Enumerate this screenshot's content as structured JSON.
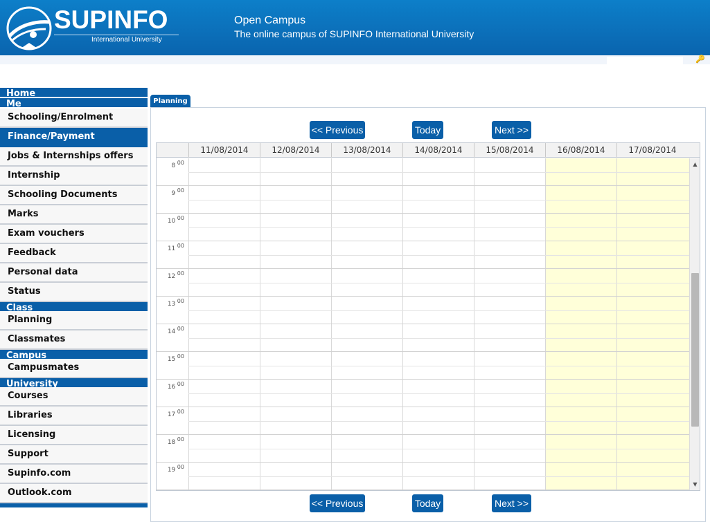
{
  "header": {
    "logo_text": "SUPINFO",
    "logo_subtitle": "International University",
    "site_title": "Open Campus",
    "site_tagline": "The online campus of SUPINFO International University"
  },
  "sidebar": {
    "home": "Home",
    "me": {
      "title": "Me",
      "items": [
        "Schooling/Enrolment",
        "Finance/Payment",
        "Jobs & Internships offers",
        "Internship",
        "Schooling Documents",
        "Marks",
        "Exam vouchers",
        "Feedback",
        "Personal data",
        "Status"
      ]
    },
    "class": {
      "title": "Class",
      "items": [
        "Planning",
        "Classmates"
      ]
    },
    "campus": {
      "title": "Campus",
      "items": [
        "Campusmates"
      ]
    },
    "university": {
      "title": "University",
      "items": [
        "Courses",
        "Libraries",
        "Licensing",
        "Support",
        "Supinfo.com",
        "Outlook.com"
      ]
    },
    "active_item": "Finance/Payment"
  },
  "main": {
    "tab_label": "Planning",
    "nav": {
      "previous": "<< Previous",
      "today": "Today",
      "next": "Next >>"
    },
    "days": [
      "11/08/2014",
      "12/08/2014",
      "13/08/2014",
      "14/08/2014",
      "15/08/2014",
      "16/08/2014",
      "17/08/2014"
    ],
    "weekend_days": [
      "16/08/2014",
      "17/08/2014"
    ],
    "hours": [
      "8",
      "9",
      "10",
      "11",
      "12",
      "13",
      "14",
      "15",
      "16",
      "17",
      "18",
      "19"
    ],
    "minutes_label": "00"
  },
  "colors": {
    "header_blue": "#0a64ae",
    "nav_blue": "#0a5fa8",
    "weekend_yellow": "#ffffd9"
  }
}
